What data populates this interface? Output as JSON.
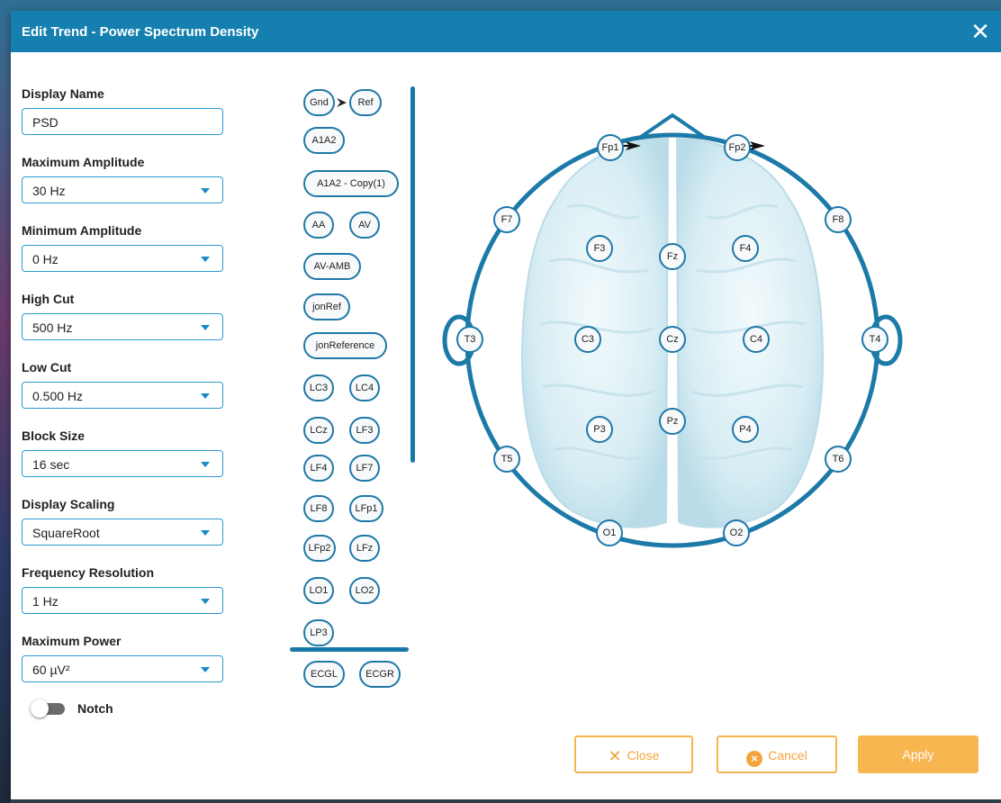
{
  "dialog": {
    "title": "Edit Trend - Power Spectrum Density"
  },
  "form": {
    "display_name": {
      "label": "Display Name",
      "value": "PSD"
    },
    "max_amplitude": {
      "label": "Maximum Amplitude",
      "value": "30 Hz"
    },
    "min_amplitude": {
      "label": "Minimum Amplitude",
      "value": "0 Hz"
    },
    "high_cut": {
      "label": "High Cut",
      "value": "500 Hz"
    },
    "low_cut": {
      "label": "Low Cut",
      "value": "0.500 Hz"
    },
    "block_size": {
      "label": "Block Size",
      "value": "16 sec"
    },
    "display_scaling": {
      "label": "Display Scaling",
      "value": "SquareRoot"
    },
    "freq_resolution": {
      "label": "Frequency Resolution",
      "value": "1 Hz"
    },
    "max_power": {
      "label": "Maximum Power",
      "value": "60 µV²"
    },
    "notch": {
      "label": "Notch",
      "on": false
    }
  },
  "montages": [
    "Gnd",
    "Ref",
    "A1A2",
    "A1A2 - Copy(1)",
    "AA",
    "AV",
    "AV-AMB",
    "jonRef",
    "jonReference",
    "LC3",
    "LC4",
    "LCz",
    "LF3",
    "LF4",
    "LF7",
    "LF8",
    "LFp1",
    "LFp2",
    "LFz",
    "LO1",
    "LO2",
    "LP3"
  ],
  "ecg": [
    "ECGL",
    "ECGR"
  ],
  "electrodes": {
    "fp1": "Fp1",
    "fp2": "Fp2",
    "f7": "F7",
    "f8": "F8",
    "f3": "F3",
    "fz": "Fz",
    "f4": "F4",
    "t3": "T3",
    "c3": "C3",
    "cz": "Cz",
    "c4": "C4",
    "t4": "T4",
    "t5": "T5",
    "p3": "P3",
    "pz": "Pz",
    "p4": "P4",
    "t6": "T6",
    "o1": "O1",
    "o2": "O2"
  },
  "buttons": {
    "close": "Close",
    "cancel": "Cancel",
    "apply": "Apply"
  },
  "colors": {
    "header": "#1580b0",
    "accent": "#1f78a8",
    "button": "#f8b651"
  }
}
